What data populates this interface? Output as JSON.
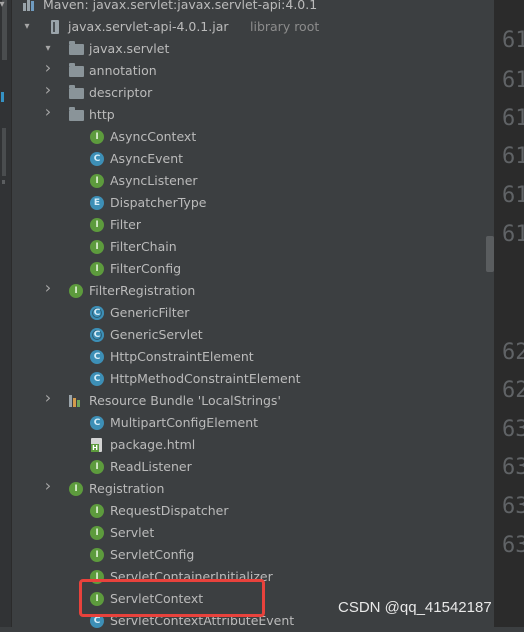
{
  "colors": {
    "panel_bg": "#3c3f41",
    "gutter_bg": "#2b2b2b",
    "highlight": "#e8423c",
    "interface_icon": "#5d9b3d",
    "class_icon": "#3d8fb6"
  },
  "tree": {
    "rows": [
      {
        "label": "Maven: javax.servlet:javax.servlet-api:4.0.1",
        "icon": "maven-library-icon",
        "arrow": "expanded"
      },
      {
        "label": "javax.servlet-api-4.0.1.jar",
        "sub": "library root",
        "icon": "jar-icon",
        "arrow": "expanded"
      },
      {
        "label": "javax.servlet",
        "icon": "package-folder-icon",
        "arrow": "expanded"
      },
      {
        "label": "annotation",
        "icon": "package-folder-icon",
        "arrow": "collapsed"
      },
      {
        "label": "descriptor",
        "icon": "package-folder-icon",
        "arrow": "collapsed"
      },
      {
        "label": "http",
        "icon": "package-folder-icon",
        "arrow": "collapsed"
      },
      {
        "label": "AsyncContext",
        "icon": "interface-icon",
        "badge": "I"
      },
      {
        "label": "AsyncEvent",
        "icon": "class-icon",
        "badge": "C"
      },
      {
        "label": "AsyncListener",
        "icon": "interface-icon",
        "badge": "I"
      },
      {
        "label": "DispatcherType",
        "icon": "enum-icon",
        "badge": "E"
      },
      {
        "label": "Filter",
        "icon": "interface-icon",
        "badge": "I"
      },
      {
        "label": "FilterChain",
        "icon": "interface-icon",
        "badge": "I"
      },
      {
        "label": "FilterConfig",
        "icon": "interface-icon",
        "badge": "I"
      },
      {
        "label": "FilterRegistration",
        "icon": "interface-icon",
        "badge": "I",
        "arrow": "collapsed"
      },
      {
        "label": "GenericFilter",
        "icon": "abstract-class-icon",
        "badge": "C"
      },
      {
        "label": "GenericServlet",
        "icon": "abstract-class-icon",
        "badge": "C"
      },
      {
        "label": "HttpConstraintElement",
        "icon": "class-icon",
        "badge": "C"
      },
      {
        "label": "HttpMethodConstraintElement",
        "icon": "class-icon",
        "badge": "C"
      },
      {
        "label": "Resource Bundle 'LocalStrings'",
        "icon": "resource-bundle-icon",
        "arrow": "collapsed"
      },
      {
        "label": "MultipartConfigElement",
        "icon": "class-icon",
        "badge": "C"
      },
      {
        "label": "package.html",
        "icon": "html-file-icon"
      },
      {
        "label": "ReadListener",
        "icon": "interface-icon",
        "badge": "I"
      },
      {
        "label": "Registration",
        "icon": "interface-icon",
        "badge": "I",
        "arrow": "collapsed"
      },
      {
        "label": "RequestDispatcher",
        "icon": "interface-icon",
        "badge": "I"
      },
      {
        "label": "Servlet",
        "icon": "interface-icon",
        "badge": "I"
      },
      {
        "label": "ServletConfig",
        "icon": "interface-icon",
        "badge": "I"
      },
      {
        "label": "ServletContainerInitializer",
        "icon": "interface-icon",
        "badge": "I"
      },
      {
        "label": "ServletContext",
        "icon": "interface-icon",
        "badge": "I"
      },
      {
        "label": "ServletContextAttributeEvent",
        "icon": "class-icon",
        "badge": "C"
      }
    ]
  },
  "gutter": {
    "line_numbers": [
      "61",
      "61",
      "61",
      "61",
      "61",
      "61",
      "62",
      "62",
      "63",
      "63",
      "63",
      "63"
    ]
  },
  "watermark": "CSDN @qq_41542187"
}
